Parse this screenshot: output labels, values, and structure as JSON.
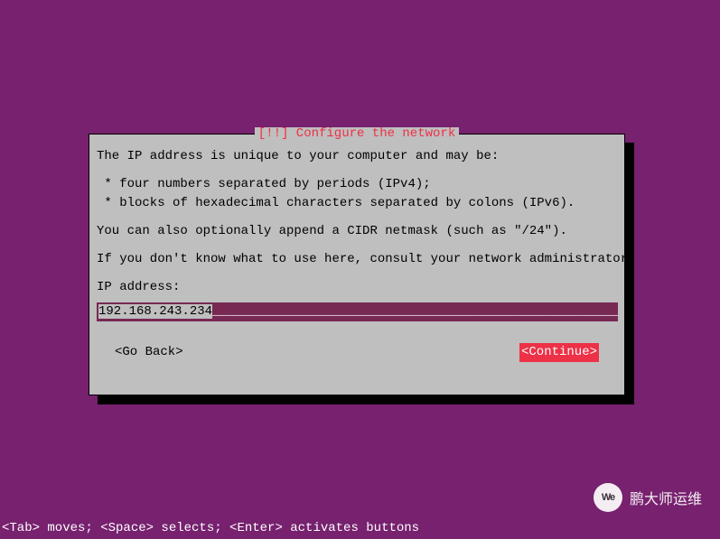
{
  "dialog": {
    "title": "[!!] Configure the network",
    "intro": "The IP address is unique to your computer and may be:",
    "bullet1": " * four numbers separated by periods (IPv4);",
    "bullet2": " * blocks of hexadecimal characters separated by colons (IPv6).",
    "cidr_line": "You can also optionally append a CIDR netmask (such as \"/24\").",
    "consult_line": "If you don't know what to use here, consult your network administrator.",
    "field_label": "IP address:",
    "field_value": "192.168.243.234",
    "back_button": "<Go Back>",
    "continue_button": "<Continue>"
  },
  "help_bar": "<Tab> moves; <Space> selects; <Enter> activates buttons",
  "watermark": {
    "text": "鹏大师运维",
    "icon_label": "We"
  }
}
